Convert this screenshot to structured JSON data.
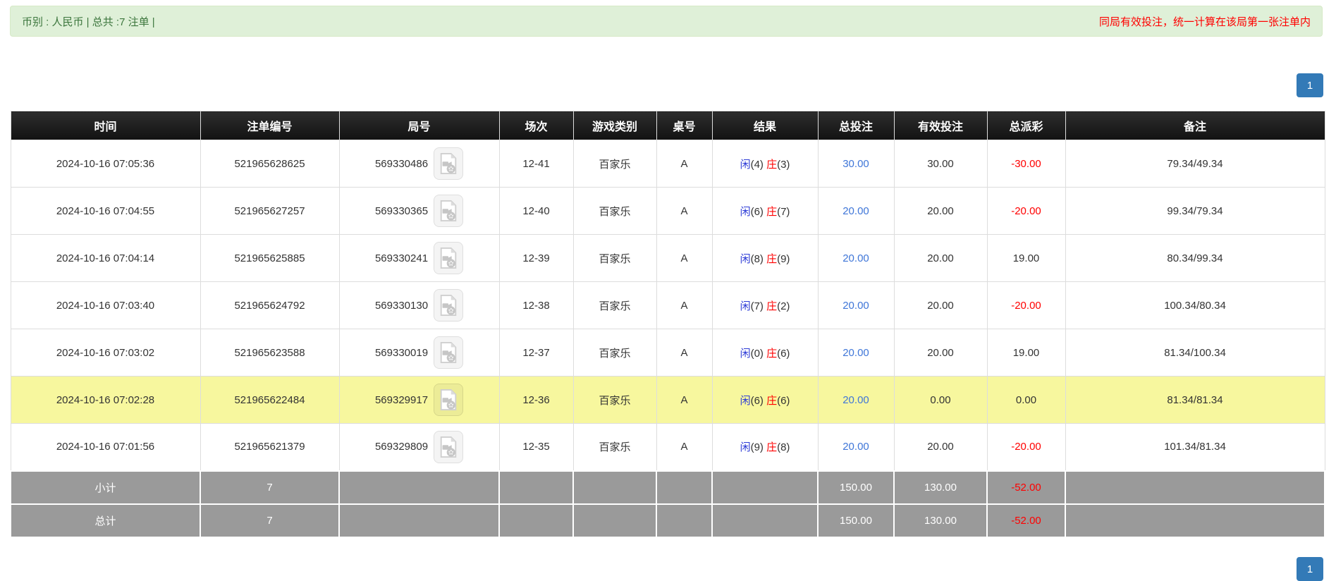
{
  "alert": {
    "currency_info": "币别 : 人民币 | 总共 :7 注单 |",
    "notice": "同局有效投注，统一计算在该局第一张注单内"
  },
  "pagination": {
    "top_page": "1",
    "bottom_page": "1"
  },
  "icons": {
    "round_cell": "video-file-icon"
  },
  "table": {
    "headers": [
      {
        "key": "time",
        "label": "时间"
      },
      {
        "key": "bet-no",
        "label": "注单编号"
      },
      {
        "key": "round-no",
        "label": "局号"
      },
      {
        "key": "session",
        "label": "场次"
      },
      {
        "key": "game-type",
        "label": "游戏类别"
      },
      {
        "key": "table-no",
        "label": "桌号"
      },
      {
        "key": "result",
        "label": "结果"
      },
      {
        "key": "total-bet",
        "label": "总投注"
      },
      {
        "key": "valid-bet",
        "label": "有效投注"
      },
      {
        "key": "payout",
        "label": "总派彩"
      },
      {
        "key": "remark",
        "label": "备注"
      }
    ],
    "rows": [
      {
        "time": "2024-10-16 07:05:36",
        "bet_no": "521965628625",
        "round_no": "569330486",
        "session": "12-41",
        "game": "百家乐",
        "table_no": "A",
        "result": {
          "p_label": "闲",
          "p": "(4)",
          "b_label": "庄",
          "b": "(3)"
        },
        "total_bet": "30.00",
        "valid_bet": "30.00",
        "payout": "-30.00",
        "remark": "79.34/49.34",
        "highlight": false
      },
      {
        "time": "2024-10-16 07:04:55",
        "bet_no": "521965627257",
        "round_no": "569330365",
        "session": "12-40",
        "game": "百家乐",
        "table_no": "A",
        "result": {
          "p_label": "闲",
          "p": "(6)",
          "b_label": "庄",
          "b": "(7)"
        },
        "total_bet": "20.00",
        "valid_bet": "20.00",
        "payout": "-20.00",
        "remark": "99.34/79.34",
        "highlight": false
      },
      {
        "time": "2024-10-16 07:04:14",
        "bet_no": "521965625885",
        "round_no": "569330241",
        "session": "12-39",
        "game": "百家乐",
        "table_no": "A",
        "result": {
          "p_label": "闲",
          "p": "(8)",
          "b_label": "庄",
          "b": "(9)"
        },
        "total_bet": "20.00",
        "valid_bet": "20.00",
        "payout": "19.00",
        "remark": "80.34/99.34",
        "highlight": false
      },
      {
        "time": "2024-10-16 07:03:40",
        "bet_no": "521965624792",
        "round_no": "569330130",
        "session": "12-38",
        "game": "百家乐",
        "table_no": "A",
        "result": {
          "p_label": "闲",
          "p": "(7)",
          "b_label": "庄",
          "b": "(2)"
        },
        "total_bet": "20.00",
        "valid_bet": "20.00",
        "payout": "-20.00",
        "remark": "100.34/80.34",
        "highlight": false
      },
      {
        "time": "2024-10-16 07:03:02",
        "bet_no": "521965623588",
        "round_no": "569330019",
        "session": "12-37",
        "game": "百家乐",
        "table_no": "A",
        "result": {
          "p_label": "闲",
          "p": "(0)",
          "b_label": "庄",
          "b": "(6)"
        },
        "total_bet": "20.00",
        "valid_bet": "20.00",
        "payout": "19.00",
        "remark": "81.34/100.34",
        "highlight": false
      },
      {
        "time": "2024-10-16 07:02:28",
        "bet_no": "521965622484",
        "round_no": "569329917",
        "session": "12-36",
        "game": "百家乐",
        "table_no": "A",
        "result": {
          "p_label": "闲",
          "p": "(6)",
          "b_label": "庄",
          "b": "(6)"
        },
        "total_bet": "20.00",
        "valid_bet": "0.00",
        "payout": "0.00",
        "remark": "81.34/81.34",
        "highlight": true
      },
      {
        "time": "2024-10-16 07:01:56",
        "bet_no": "521965621379",
        "round_no": "569329809",
        "session": "12-35",
        "game": "百家乐",
        "table_no": "A",
        "result": {
          "p_label": "闲",
          "p": "(9)",
          "b_label": "庄",
          "b": "(8)"
        },
        "total_bet": "20.00",
        "valid_bet": "20.00",
        "payout": "-20.00",
        "remark": "101.34/81.34",
        "highlight": false
      }
    ],
    "subtotal": {
      "label": "小计",
      "count": "7",
      "total_bet": "150.00",
      "valid_bet": "130.00",
      "payout": "-52.00"
    },
    "grand_total": {
      "label": "总计",
      "count": "7",
      "total_bet": "150.00",
      "valid_bet": "130.00",
      "payout": "-52.00"
    }
  },
  "colors": {
    "alert_bg": "#dff0d8",
    "alert_border": "#d6e9c6",
    "alert_text": "#3c763d",
    "notice_red": "#ff0000",
    "pager_blue": "#337ab7",
    "header_bg_top": "#2d2d2d",
    "header_bg_bottom": "#121212",
    "player_blue": "#2d3cd6",
    "banker_red": "#ff0000",
    "link_blue": "#3f76d8",
    "negative_red": "#ff0000",
    "highlight_yellow": "#f7f79e",
    "summary_bg": "#9a9a9a",
    "border_gray": "#dddddd",
    "text_dark": "#333333"
  }
}
